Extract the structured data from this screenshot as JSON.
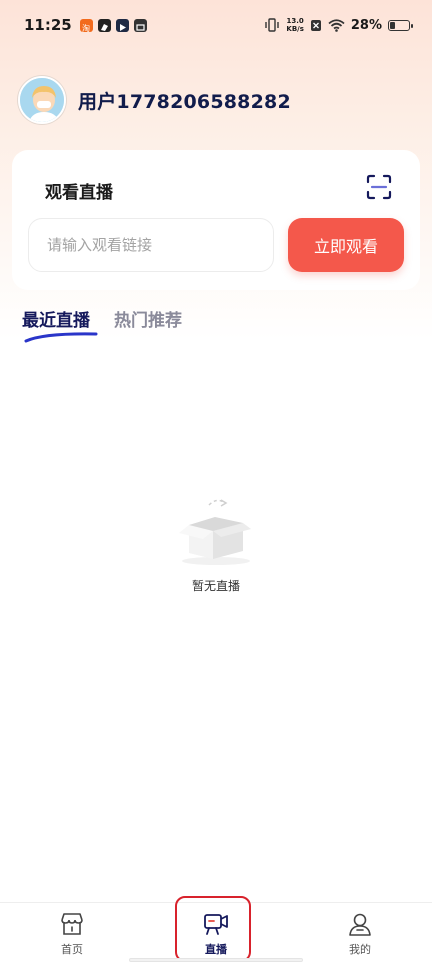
{
  "status_bar": {
    "time": "11:25",
    "net_speed_value": "13.0",
    "net_speed_unit": "KB/s",
    "battery_percent": "28%",
    "battery_level": 0.28
  },
  "user": {
    "name": "用户1778206588282"
  },
  "watch_card": {
    "title": "观看直播",
    "input_placeholder": "请输入观看链接",
    "input_value": "",
    "watch_button_label": "立即观看"
  },
  "tabs": [
    {
      "label": "最近直播",
      "active": true
    },
    {
      "label": "热门推荐",
      "active": false
    }
  ],
  "empty_state": {
    "text": "暂无直播"
  },
  "bottom_nav": {
    "items": [
      {
        "label": "首页",
        "icon": "store-icon",
        "active": false
      },
      {
        "label": "直播",
        "icon": "video-camera-icon",
        "active": true
      },
      {
        "label": "我的",
        "icon": "user-icon",
        "active": false
      }
    ]
  },
  "colors": {
    "accent": "#f4584b",
    "brand_navy": "#15195c",
    "highlight": "#d8222c"
  }
}
